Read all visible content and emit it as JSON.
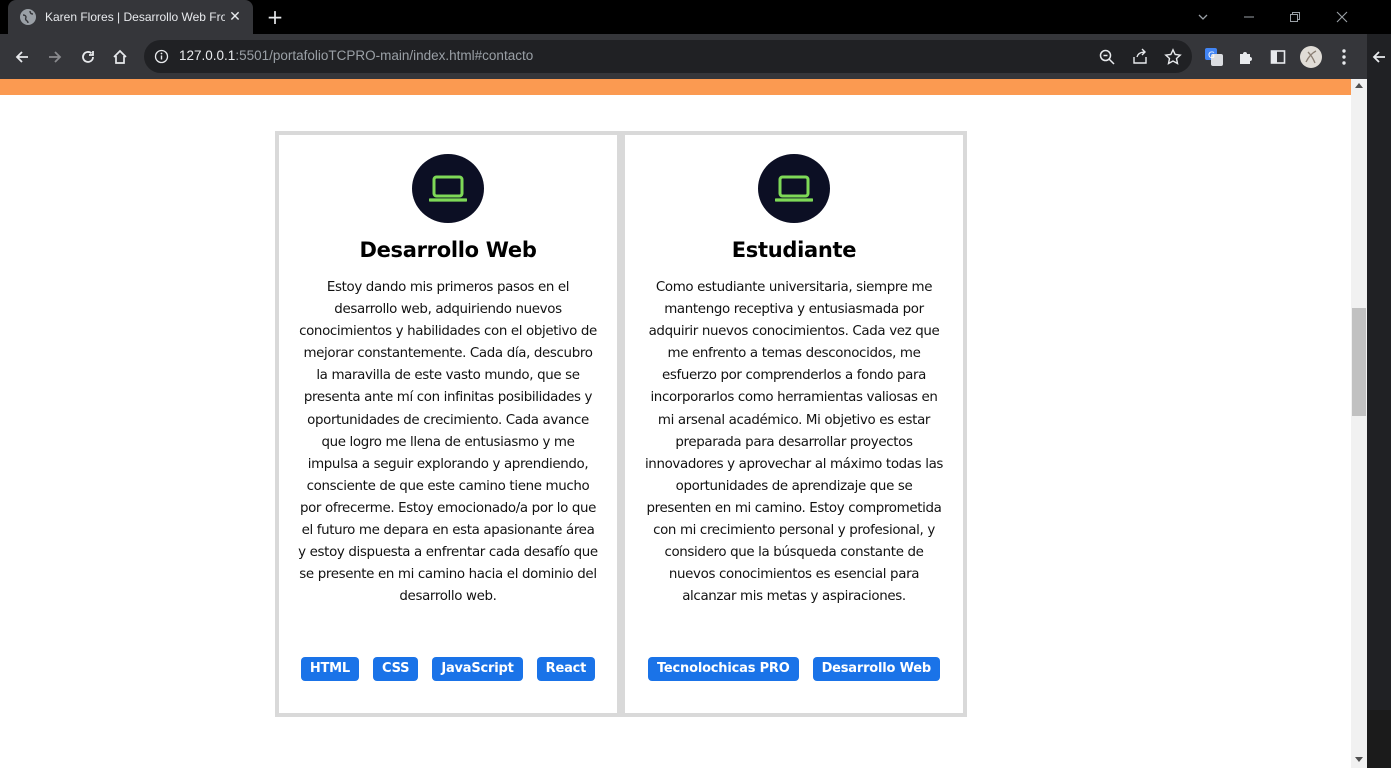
{
  "browser": {
    "tab_title": "Karen Flores | Desarrollo Web Fro",
    "url_host": "127.0.0.1",
    "url_rest": ":5501/portafolioTCPRO-main/index.html#contacto"
  },
  "colors": {
    "accent_orange": "#fb9a51",
    "icon_circle": "#0c0f24",
    "laptop_green": "#7ed957",
    "tag_blue": "#1a73e8"
  },
  "cards": [
    {
      "icon": "laptop-icon",
      "title": "Desarrollo Web",
      "text": "Estoy dando mis primeros pasos en el desarrollo web, adquiriendo nuevos conocimientos y habilidades con el objetivo de mejorar constantemente. Cada día, descubro la maravilla de este vasto mundo, que se presenta ante mí con infinitas posibilidades y oportunidades de crecimiento. Cada avance que logro me llena de entusiasmo y me impulsa a seguir explorando y aprendiendo, consciente de que este camino tiene mucho por ofrecerme. Estoy emocionado/a por lo que el futuro me depara en esta apasionante área y estoy dispuesta a enfrentar cada desafío que se presente en mi camino hacia el dominio del desarrollo web.",
      "tags": [
        "HTML",
        "CSS",
        "JavaScript",
        "React"
      ]
    },
    {
      "icon": "laptop-icon",
      "title": "Estudiante",
      "text": "Como estudiante universitaria, siempre me mantengo receptiva y entusiasmada por adquirir nuevos conocimientos. Cada vez que me enfrento a temas desconocidos, me esfuerzo por comprenderlos a fondo para incorporarlos como herramientas valiosas en mi arsenal académico. Mi objetivo es estar preparada para desarrollar proyectos innovadores y aprovechar al máximo todas las oportunidades de aprendizaje que se presenten en mi camino. Estoy comprometida con mi crecimiento personal y profesional, y considero que la búsqueda constante de nuevos conocimientos es esencial para alcanzar mis metas y aspiraciones.",
      "tags": [
        "Tecnolochicas PRO",
        "Desarrollo Web"
      ]
    }
  ]
}
